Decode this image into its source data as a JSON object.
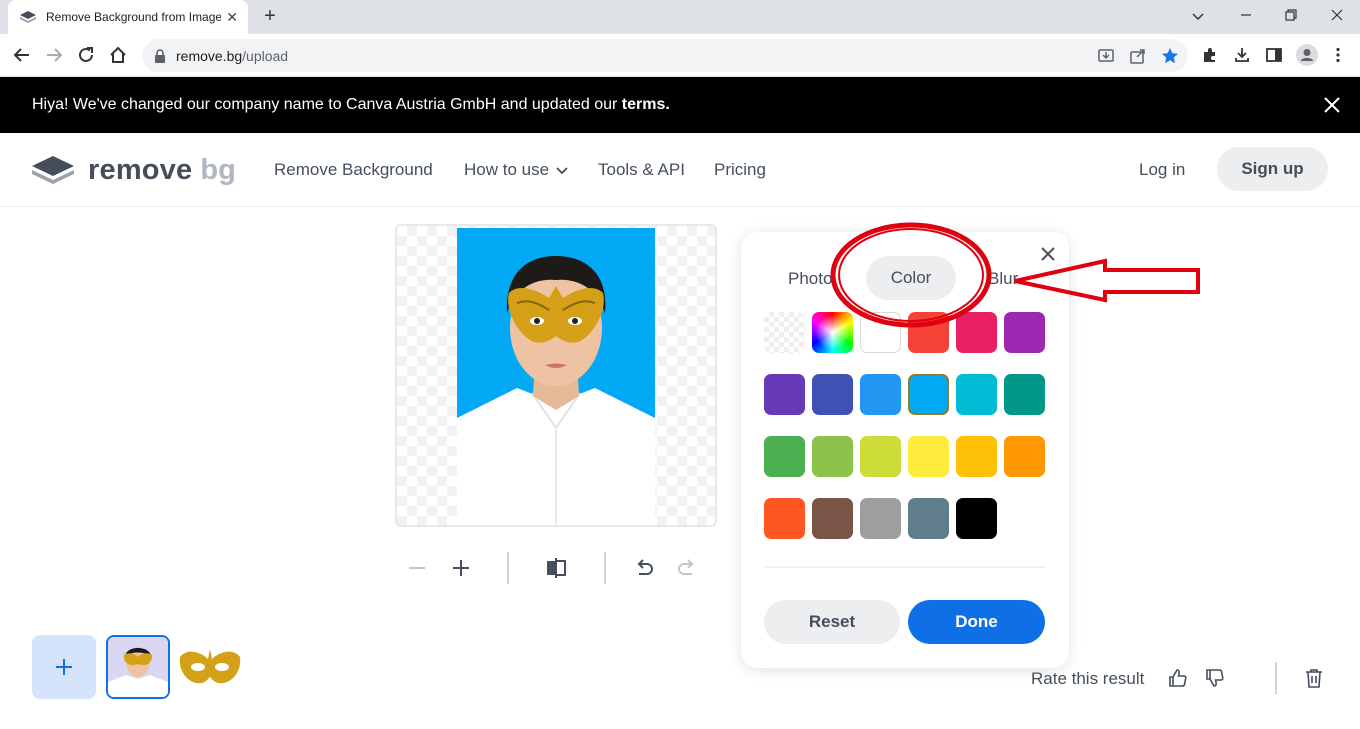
{
  "browser": {
    "tab_title": "Remove Background from Image",
    "url_host": "remove.bg",
    "url_path": "/upload"
  },
  "banner": {
    "message": "Hiya! We've changed our company name to Canva Austria GmbH and updated our ",
    "link": "terms."
  },
  "header": {
    "logo_word1": "remove",
    "logo_word2": "bg",
    "nav": [
      "Remove Background",
      "How to use",
      "Tools & API",
      "Pricing"
    ],
    "login": "Log in",
    "signup": "Sign up"
  },
  "panel": {
    "tabs": [
      "Photo",
      "Color",
      "Blur"
    ],
    "active_tab": "Color",
    "swatches": [
      "transparent",
      "rainbow",
      "#ffffff",
      "#f44336",
      "#e91e63",
      "#9c27b0",
      "#673ab7",
      "#3f51b5",
      "#2196f3",
      "#03a9f4",
      "#00bcd4",
      "#009688",
      "#4caf50",
      "#8bc34a",
      "#cddc39",
      "#ffeb3b",
      "#ffc107",
      "#ff9800",
      "#ff5722",
      "#795548",
      "#9e9e9e",
      "#607d8b",
      "#000000"
    ],
    "selected_color": "#03a9f4",
    "reset_label": "Reset",
    "done_label": "Done"
  },
  "preview": {
    "background_color": "#03a9f4"
  },
  "footer": {
    "rate_label": "Rate this result"
  },
  "colors": {
    "brand_blue": "#0f70e6",
    "annotation_red": "#e0000f"
  }
}
